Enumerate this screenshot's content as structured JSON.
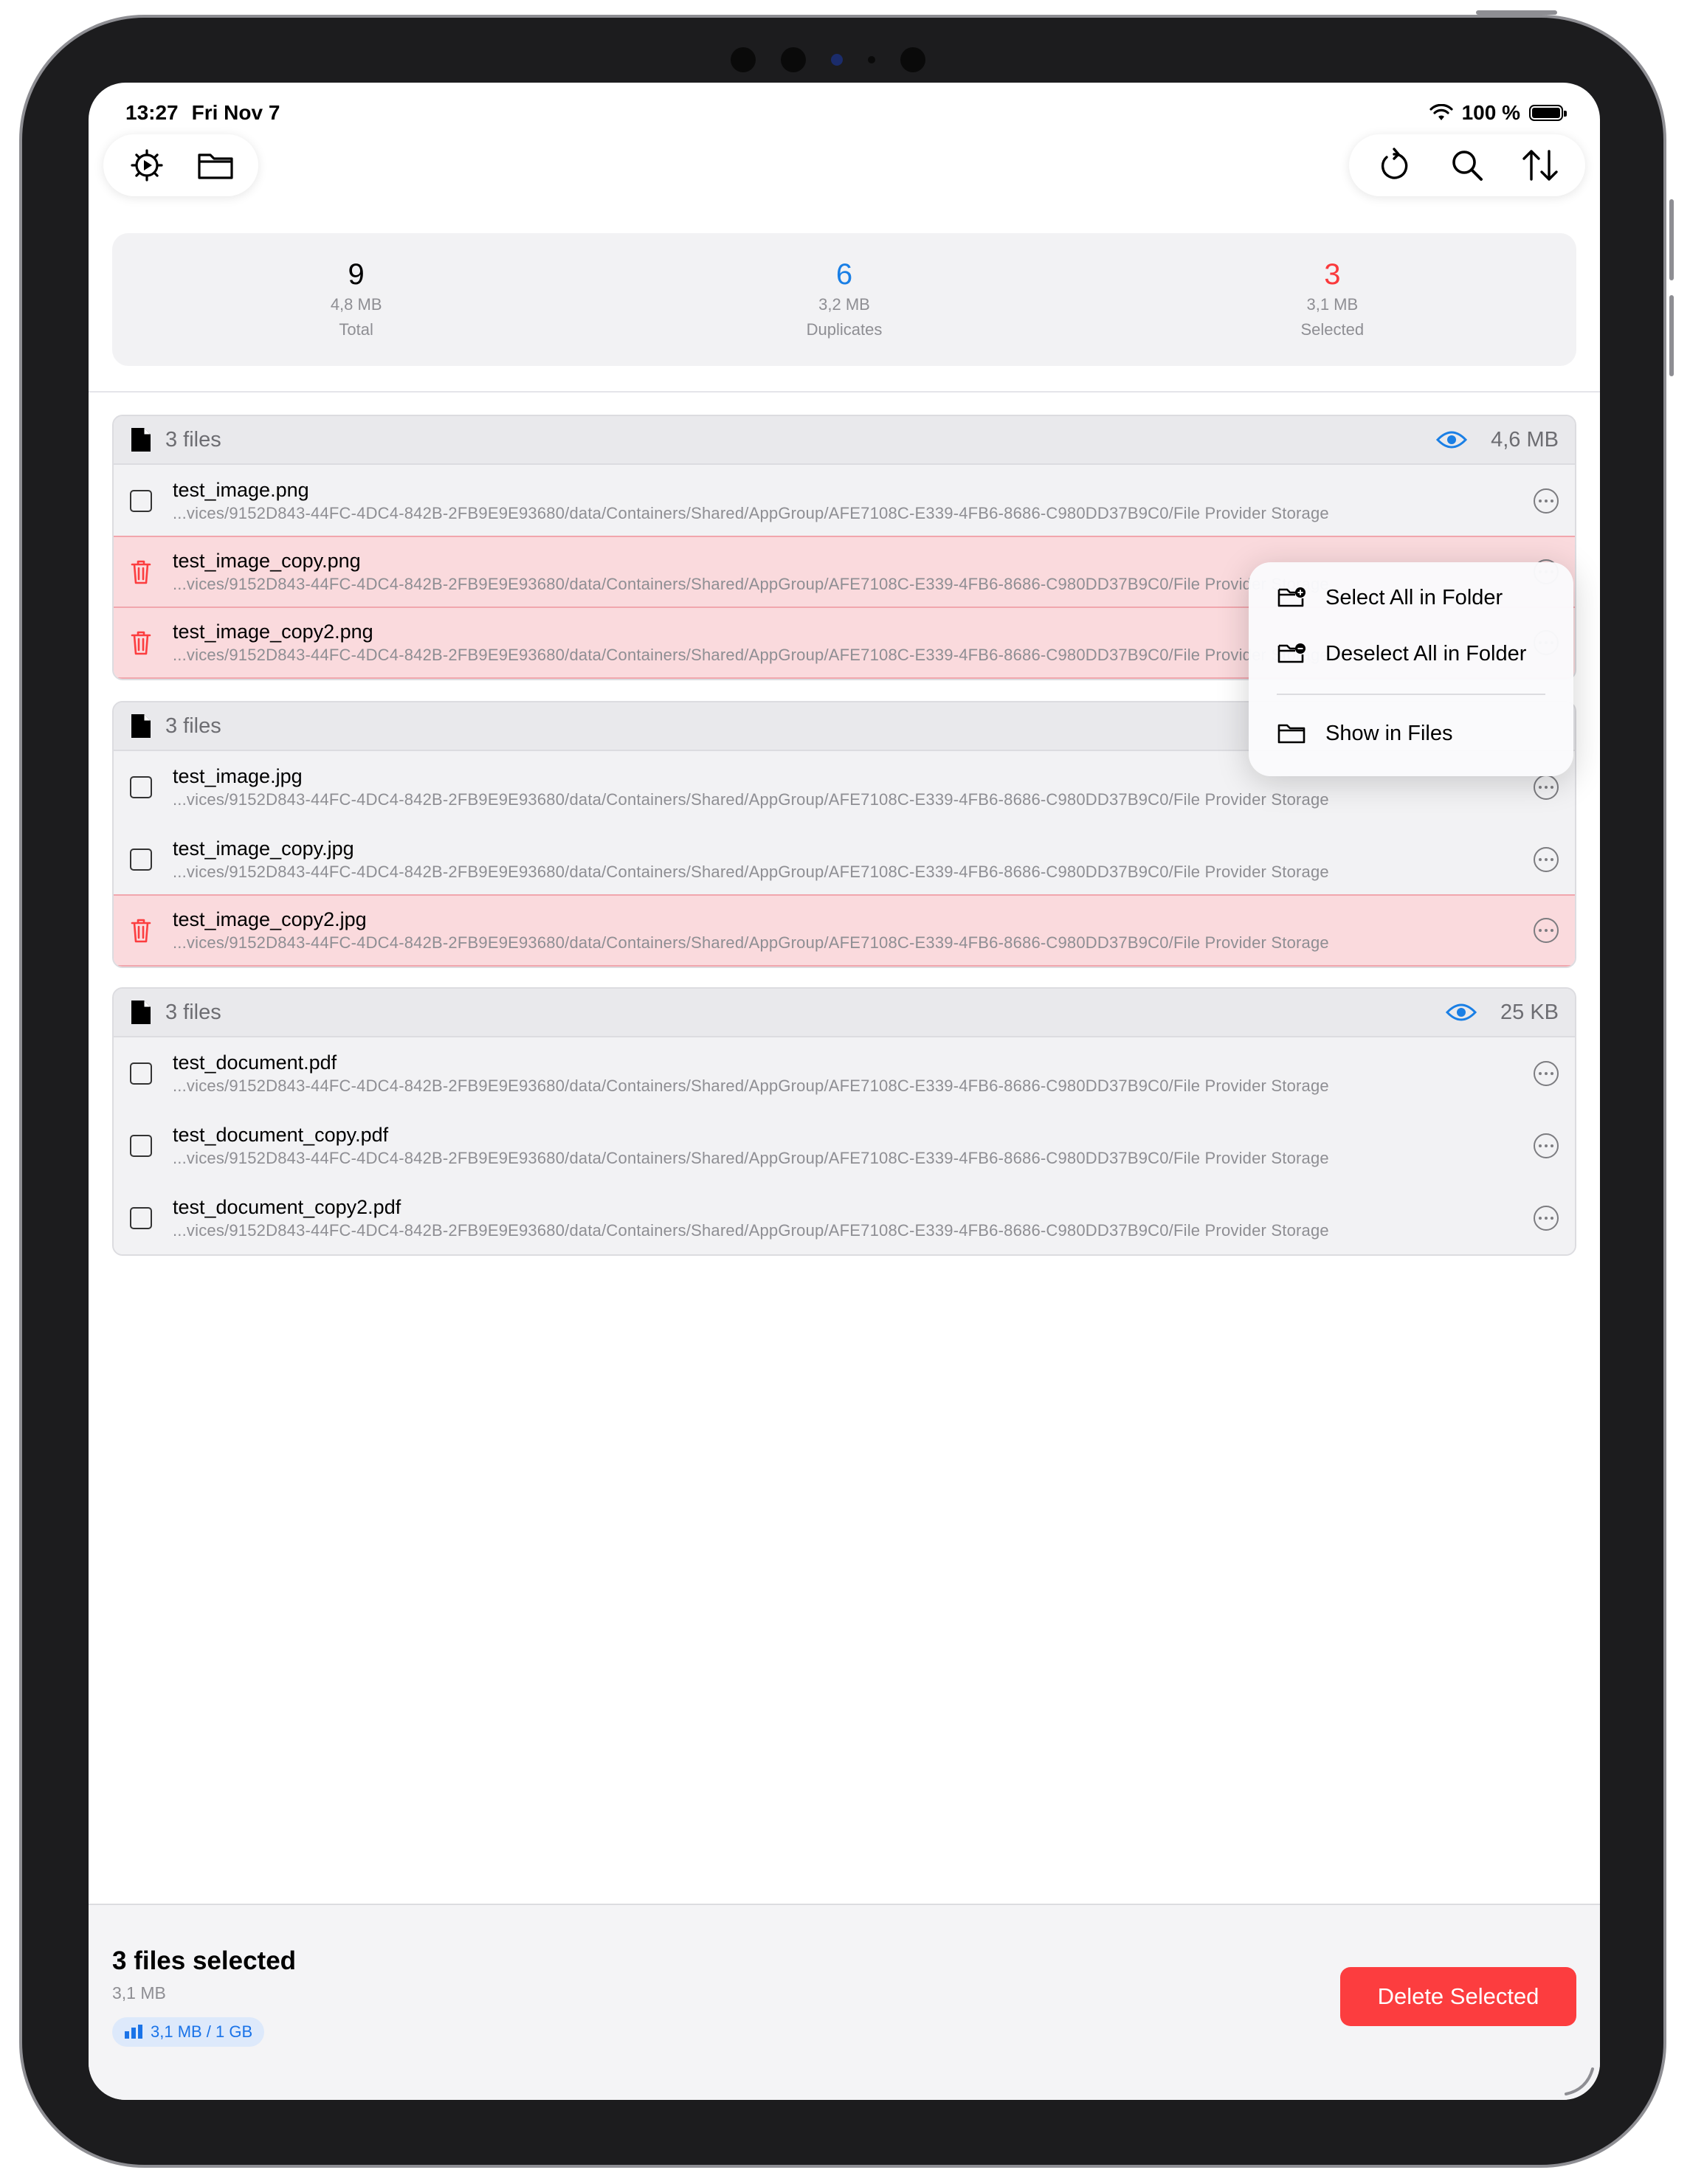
{
  "status_bar": {
    "time": "13:27",
    "date": "Fri Nov 7",
    "battery": "100 %"
  },
  "toolbar": {
    "left": [
      {
        "icon": "gear-play-icon"
      },
      {
        "icon": "folder-icon"
      }
    ],
    "right": [
      {
        "icon": "refresh-icon"
      },
      {
        "icon": "search-icon"
      },
      {
        "icon": "sort-icon"
      }
    ]
  },
  "summary": {
    "total": {
      "value": "9",
      "size": "4,8 MB",
      "label": "Total",
      "color": "#000000"
    },
    "duplicates": {
      "value": "6",
      "size": "3,2 MB",
      "label": "Duplicates",
      "color": "#1a7fe5"
    },
    "selected": {
      "value": "3",
      "size": "3,1 MB",
      "label": "Selected",
      "color": "#fa3a3c"
    }
  },
  "groups": [
    {
      "count": "3 files",
      "size": "4,6 MB",
      "files": [
        {
          "name": "test_image.png",
          "path": "...vices/9152D843-44FC-4DC4-842B-2FB9E9E93680/data/Containers/Shared/AppGroup/AFE7108C-E339-4FB6-8686-C980DD37B9C0/File Provider Storage",
          "state": "keep"
        },
        {
          "name": "test_image_copy.png",
          "path": "...vices/9152D843-44FC-4DC4-842B-2FB9E9E93680/data/Containers/Shared/AppGroup/AFE7108C-E339-4FB6-8686-C980DD37B9C0/File Provider Storage",
          "state": "delete"
        },
        {
          "name": "test_image_copy2.png",
          "path": "...vices/9152D843-44FC-4DC4-842B-2FB9E9E93680/data/Containers/Shared/AppGroup/AFE7108C-E339-4FB6-8686-C980DD37B9C0/File Provider Storage",
          "state": "delete"
        }
      ]
    },
    {
      "count": "3 files",
      "size": "",
      "files": [
        {
          "name": "test_image.jpg",
          "path": "...vices/9152D843-44FC-4DC4-842B-2FB9E9E93680/data/Containers/Shared/AppGroup/AFE7108C-E339-4FB6-8686-C980DD37B9C0/File Provider Storage",
          "state": "keep"
        },
        {
          "name": "test_image_copy.jpg",
          "path": "...vices/9152D843-44FC-4DC4-842B-2FB9E9E93680/data/Containers/Shared/AppGroup/AFE7108C-E339-4FB6-8686-C980DD37B9C0/File Provider Storage",
          "state": "keep"
        },
        {
          "name": "test_image_copy2.jpg",
          "path": "...vices/9152D843-44FC-4DC4-842B-2FB9E9E93680/data/Containers/Shared/AppGroup/AFE7108C-E339-4FB6-8686-C980DD37B9C0/File Provider Storage",
          "state": "delete"
        }
      ]
    },
    {
      "count": "3 files",
      "size": "25 KB",
      "files": [
        {
          "name": "test_document.pdf",
          "path": "...vices/9152D843-44FC-4DC4-842B-2FB9E9E93680/data/Containers/Shared/AppGroup/AFE7108C-E339-4FB6-8686-C980DD37B9C0/File Provider Storage",
          "state": "keep"
        },
        {
          "name": "test_document_copy.pdf",
          "path": "...vices/9152D843-44FC-4DC4-842B-2FB9E9E93680/data/Containers/Shared/AppGroup/AFE7108C-E339-4FB6-8686-C980DD37B9C0/File Provider Storage",
          "state": "keep"
        },
        {
          "name": "test_document_copy2.pdf",
          "path": "...vices/9152D843-44FC-4DC4-842B-2FB9E9E93680/data/Containers/Shared/AppGroup/AFE7108C-E339-4FB6-8686-C980DD37B9C0/File Provider Storage",
          "state": "keep"
        }
      ]
    }
  ],
  "context_menu": {
    "items": [
      {
        "label": "Select All in Folder",
        "icon": "folder-badge-plus-icon"
      },
      {
        "label": "Deselect All in Folder",
        "icon": "folder-badge-minus-icon"
      },
      {
        "label": "Show in Files",
        "icon": "folder-icon"
      }
    ]
  },
  "bottom_bar": {
    "title": "3 files selected",
    "size": "3,1 MB",
    "quota": "3,1 MB / 1 GB",
    "delete_label": "Delete Selected"
  },
  "colors": {
    "accent": "#1a7fe5",
    "danger": "#fc3d3f",
    "deleted_row": "#fadadd"
  }
}
